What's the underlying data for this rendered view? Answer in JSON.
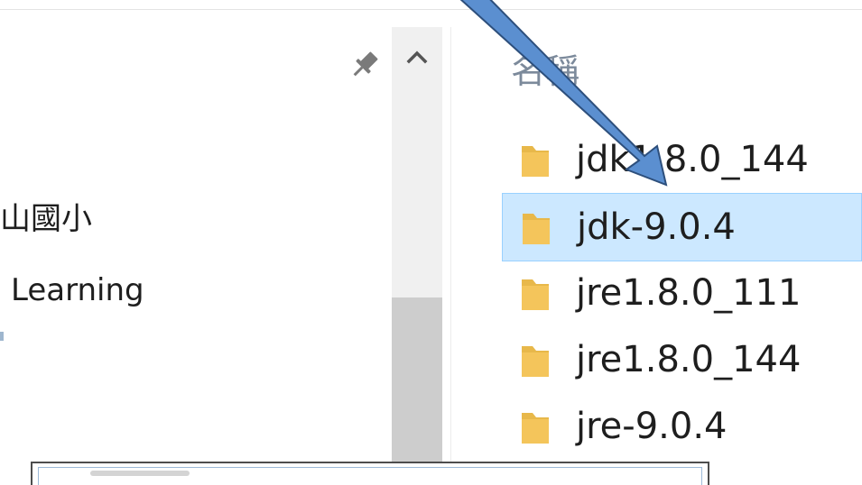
{
  "nav": {
    "items": [
      {
        "label": "山國小"
      },
      {
        "label": "Learning"
      }
    ]
  },
  "column_header": {
    "name": "名稱"
  },
  "files": [
    {
      "name": "jdk1.8.0_144",
      "selected": false
    },
    {
      "name": "jdk-9.0.4",
      "selected": true
    },
    {
      "name": "jre1.8.0_111",
      "selected": false
    },
    {
      "name": "jre1.8.0_144",
      "selected": false
    },
    {
      "name": "jre-9.0.4",
      "selected": false
    }
  ],
  "icons": {
    "pin": "pin-icon",
    "scroll_up": "chevron-up-icon",
    "folder": "folder-icon",
    "annotation": "arrow-annotation"
  },
  "colors": {
    "selection_bg": "#cce8ff",
    "selection_border": "#99d1ff",
    "folder": "#f4c55b",
    "arrow_fill": "#5b8fd0",
    "arrow_stroke": "#2d4f7c"
  }
}
